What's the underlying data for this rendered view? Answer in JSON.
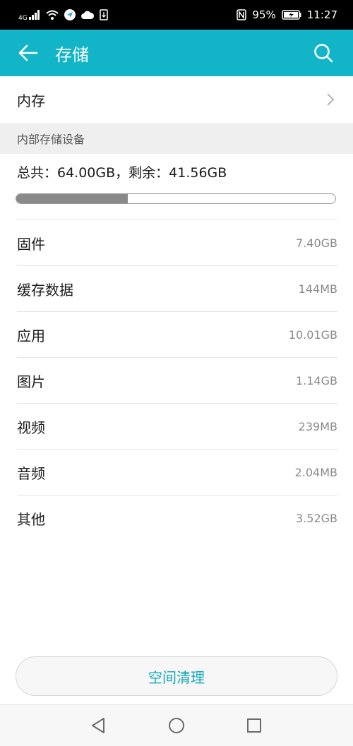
{
  "status_bar": {
    "network": "4G",
    "battery": "95%",
    "time": "11:27"
  },
  "app_bar": {
    "title": "存储"
  },
  "memory": {
    "label": "内存"
  },
  "section": {
    "title": "内部存储设备"
  },
  "summary": {
    "text": "总共：64.00GB，剩余：41.56GB",
    "used_fraction": 0.35
  },
  "items": [
    {
      "label": "固件",
      "value": "7.40GB"
    },
    {
      "label": "缓存数据",
      "value": "144MB"
    },
    {
      "label": "应用",
      "value": "10.01GB"
    },
    {
      "label": "图片",
      "value": "1.14GB"
    },
    {
      "label": "视频",
      "value": "239MB"
    },
    {
      "label": "音频",
      "value": "2.04MB"
    },
    {
      "label": "其他",
      "value": "3.52GB"
    }
  ],
  "cleanup": {
    "label": "空间清理"
  },
  "colors": {
    "accent": "#12b4c8",
    "usage_fill": "#8a8a8a"
  }
}
